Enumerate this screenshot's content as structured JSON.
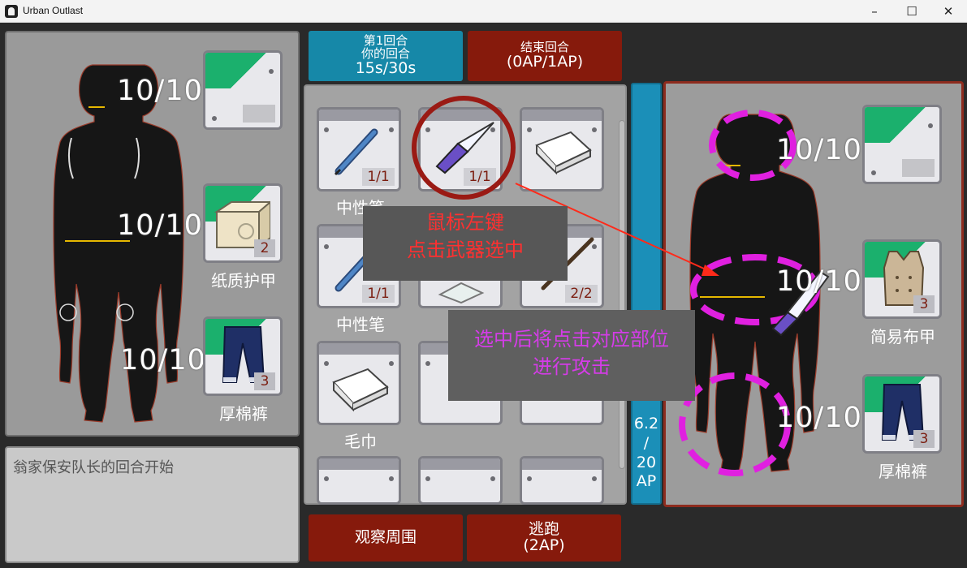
{
  "window": {
    "title": "Urban Outlast",
    "minimize": "–",
    "maximize": "☐",
    "close": "✕"
  },
  "top": {
    "turn_line1": "第1回合",
    "turn_line2": "你的回合",
    "turn_timer": "15s/30s",
    "end_line1": "结束回合",
    "end_line2": "(0AP/1AP)"
  },
  "player": {
    "head_hp": "10/10",
    "torso_hp": "10/10",
    "legs_hp": "10/10",
    "torso_armor": {
      "name": "纸质护甲",
      "count": "2"
    },
    "legs_armor": {
      "name": "厚棉裤",
      "count": "3"
    }
  },
  "log": {
    "text": "翁家保安队长的回合开始"
  },
  "inventory": {
    "items": [
      {
        "name": "中性笔",
        "qty": "1/1",
        "icon": "pen-icon"
      },
      {
        "name": "小刀",
        "qty": "1/1",
        "icon": "knife-icon"
      },
      {
        "name": "毛巾",
        "qty": "",
        "icon": "towel-icon"
      },
      {
        "name": "中性笔",
        "qty": "1/1",
        "icon": "pen-icon"
      },
      {
        "name": "",
        "qty": "",
        "icon": "gauze-icon"
      },
      {
        "name": "",
        "qty": "2/2",
        "icon": "stick-icon"
      },
      {
        "name": "毛巾",
        "qty": "",
        "icon": "towel-icon"
      },
      {
        "name": "",
        "qty": "",
        "icon": ""
      },
      {
        "name": "",
        "qty": "",
        "icon": ""
      }
    ]
  },
  "ap": {
    "line1": "6.2",
    "line2": "/",
    "line3": "20",
    "line4": "AP"
  },
  "enemy": {
    "head_hp": "10/10",
    "torso_hp": "10/10",
    "legs_hp": "10/10",
    "torso_armor": {
      "name": "简易布甲",
      "count": "3"
    },
    "legs_armor": {
      "name": "厚棉裤",
      "count": "3"
    }
  },
  "bottom": {
    "observe": "观察周围",
    "flee_line1": "逃跑",
    "flee_line2": "(2AP)"
  },
  "tutorial": {
    "box1_line1": "鼠标左键",
    "box1_line2": "点击武器选中",
    "box2_line1": "选中后将点击对应部位",
    "box2_line2": "进行攻击"
  },
  "colors": {
    "turn_button": "#1688a8",
    "red_button": "#861a0c",
    "armor_green": "#1bb06d",
    "highlight_magenta": "#e020e0",
    "annotation_red": "#ff2a1a"
  }
}
